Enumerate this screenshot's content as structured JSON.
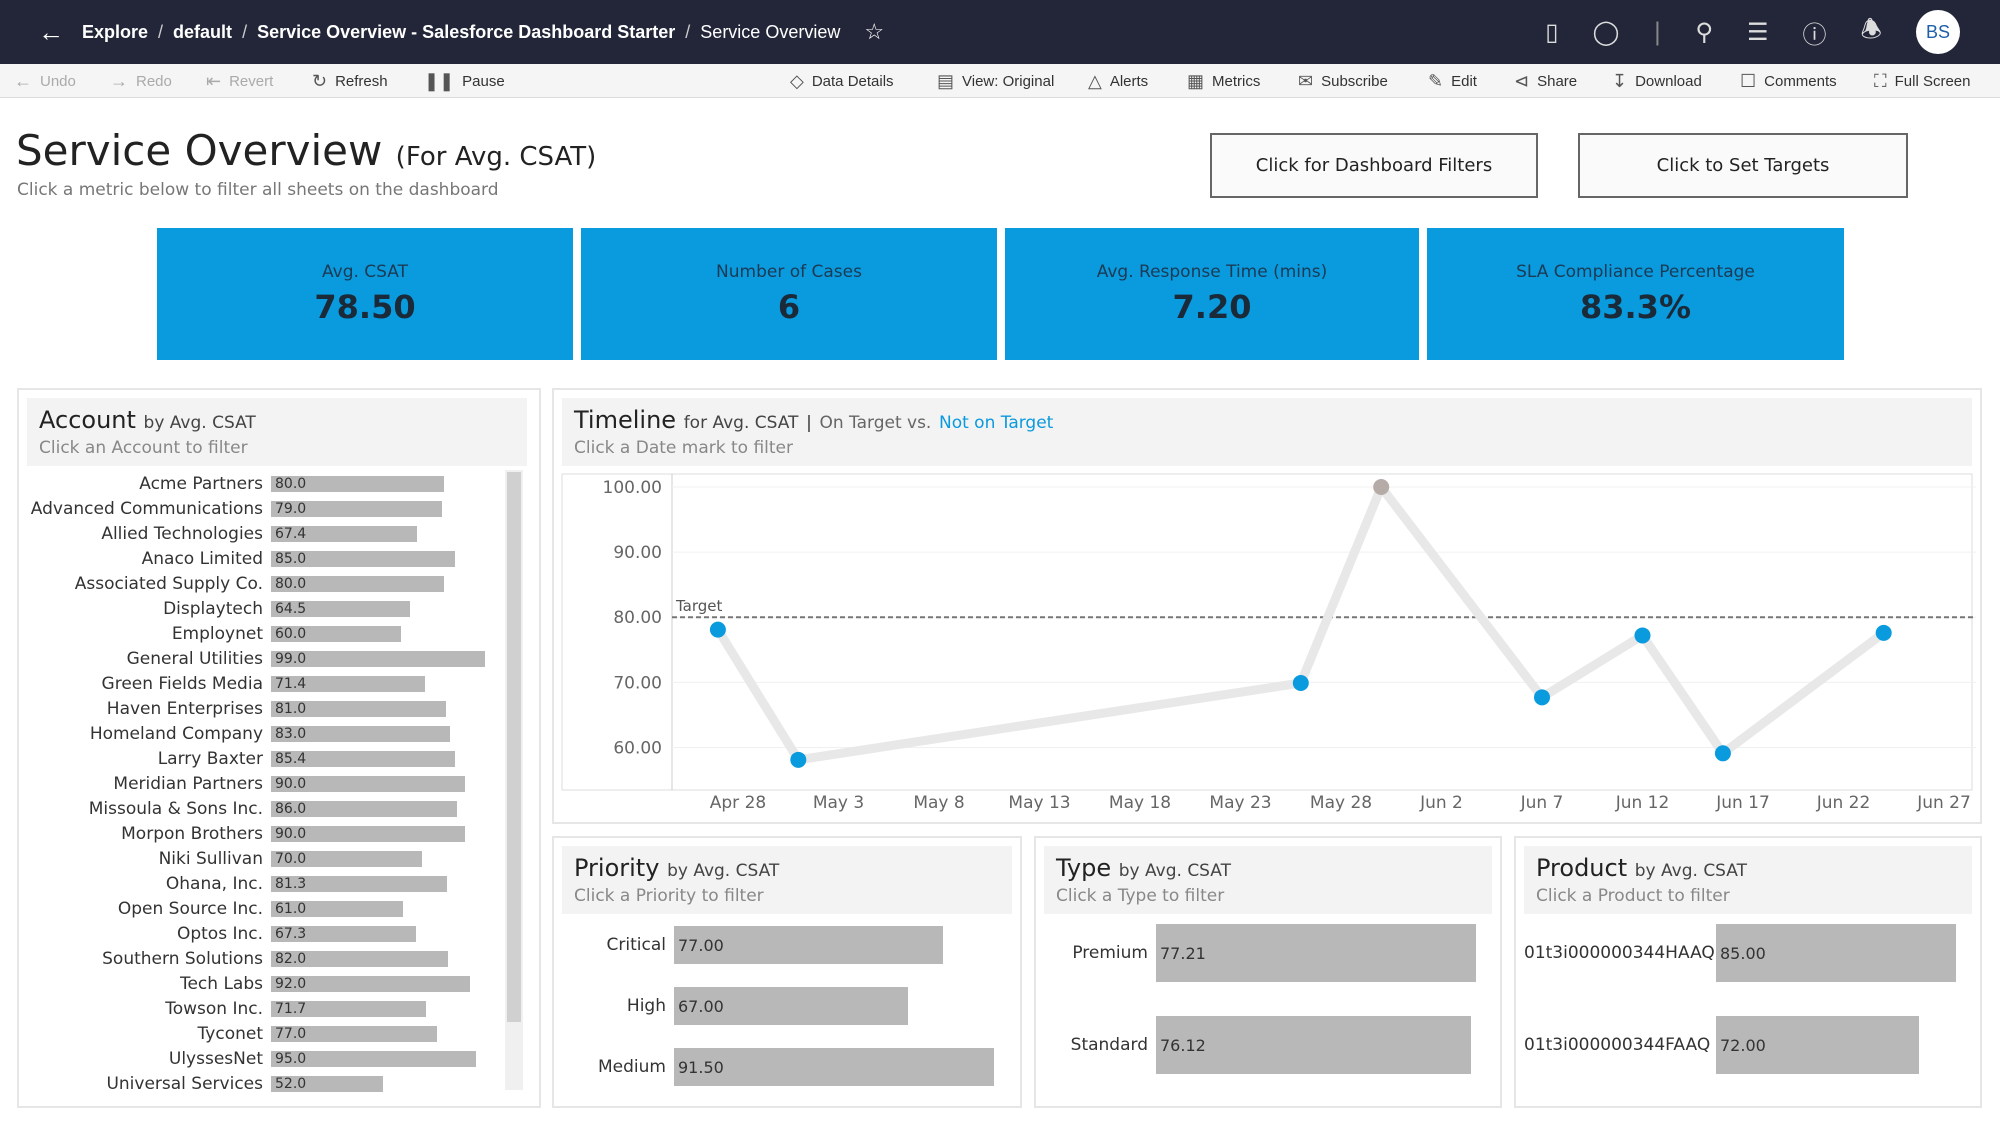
{
  "breadcrumb": {
    "items": [
      "Explore",
      "default",
      "Service Overview - Salesforce Dashboard Starter",
      "Service Overview"
    ]
  },
  "user": {
    "initials": "BS"
  },
  "toolbar": {
    "undo": "Undo",
    "redo": "Redo",
    "revert": "Revert",
    "refresh": "Refresh",
    "pause": "Pause",
    "data_details": "Data Details",
    "view": "View: Original",
    "alerts": "Alerts",
    "metrics": "Metrics",
    "subscribe": "Subscribe",
    "edit": "Edit",
    "share": "Share",
    "download": "Download",
    "comments": "Comments",
    "full_screen": "Full Screen"
  },
  "header": {
    "title": "Service Overview",
    "title_suffix": "(For Avg. CSAT)",
    "subtitle": "Click a metric below to filter all sheets on the dashboard",
    "filters_button": "Click for Dashboard Filters",
    "targets_button": "Click to Set Targets"
  },
  "kpis": [
    {
      "label": "Avg. CSAT",
      "value": "78.50"
    },
    {
      "label": "Number of Cases",
      "value": "6"
    },
    {
      "label": "Avg. Response Time (mins)",
      "value": "7.20"
    },
    {
      "label": "SLA Compliance Percentage",
      "value": "83.3%"
    }
  ],
  "colors": {
    "accent": "#0a9ade",
    "topbar": "#222638",
    "bar": "#b8b8b8",
    "not_on_target": "#0a9ade",
    "on_target": "#b5aca8"
  },
  "account": {
    "title": "Account",
    "title_suffix": "by Avg. CSAT",
    "subtitle": "Click an Account to filter",
    "items": [
      {
        "name": "Acme Partners",
        "value": "80.0"
      },
      {
        "name": "Advanced Communications",
        "value": "79.0"
      },
      {
        "name": "Allied Technologies",
        "value": "67.4"
      },
      {
        "name": "Anaco Limited",
        "value": "85.0"
      },
      {
        "name": "Associated Supply Co.",
        "value": "80.0"
      },
      {
        "name": "Displaytech",
        "value": "64.5"
      },
      {
        "name": "Employnet",
        "value": "60.0"
      },
      {
        "name": "General Utilities",
        "value": "99.0"
      },
      {
        "name": "Green Fields Media",
        "value": "71.4"
      },
      {
        "name": "Haven Enterprises",
        "value": "81.0"
      },
      {
        "name": "Homeland Company",
        "value": "83.0"
      },
      {
        "name": "Larry Baxter",
        "value": "85.4"
      },
      {
        "name": "Meridian Partners",
        "value": "90.0"
      },
      {
        "name": "Missoula & Sons Inc.",
        "value": "86.0"
      },
      {
        "name": "Morpon Brothers",
        "value": "90.0"
      },
      {
        "name": "Niki Sullivan",
        "value": "70.0"
      },
      {
        "name": "Ohana, Inc.",
        "value": "81.3"
      },
      {
        "name": "Open Source Inc.",
        "value": "61.0"
      },
      {
        "name": "Optos Inc.",
        "value": "67.3"
      },
      {
        "name": "Southern Solutions",
        "value": "82.0"
      },
      {
        "name": "Tech Labs",
        "value": "92.0"
      },
      {
        "name": "Towson Inc.",
        "value": "71.7"
      },
      {
        "name": "Tyconet",
        "value": "77.0"
      },
      {
        "name": "UlyssesNet",
        "value": "95.0"
      },
      {
        "name": "Universal Services",
        "value": "52.0"
      }
    ]
  },
  "timeline": {
    "title": "Timeline",
    "title_suffix": "for Avg. CSAT",
    "legend_on": "On Target vs.",
    "legend_not": "Not on Target",
    "subtitle": "Click a Date mark to filter"
  },
  "chart_data": {
    "type": "line",
    "y_ticks": [
      "100.00",
      "90.00",
      "80.00",
      "70.00",
      "60.00"
    ],
    "ylim": [
      55,
      102
    ],
    "x_ticks": [
      "Apr 28",
      "May 3",
      "May 8",
      "May 13",
      "May 18",
      "May 23",
      "May 28",
      "Jun 2",
      "Jun 7",
      "Jun 12",
      "Jun 17",
      "Jun 22",
      "Jun 27"
    ],
    "target": {
      "label": "Target",
      "value": 80
    },
    "points": [
      {
        "x": "Apr 27",
        "y": 78.1,
        "on_target": false
      },
      {
        "x": "May 1",
        "y": 58.1,
        "on_target": false
      },
      {
        "x": "May 26",
        "y": 69.9,
        "on_target": false
      },
      {
        "x": "May 30",
        "y": 100,
        "on_target": true
      },
      {
        "x": "Jun 7",
        "y": 67.7,
        "on_target": false
      },
      {
        "x": "Jun 12",
        "y": 77.2,
        "on_target": false
      },
      {
        "x": "Jun 16",
        "y": 59.1,
        "on_target": false
      },
      {
        "x": "Jun 24",
        "y": 77.6,
        "on_target": false
      }
    ]
  },
  "priority": {
    "title": "Priority",
    "title_suffix": "by Avg. CSAT",
    "subtitle": "Click a Priority to filter",
    "items": [
      {
        "name": "Critical",
        "value": "77.00"
      },
      {
        "name": "High",
        "value": "67.00"
      },
      {
        "name": "Medium",
        "value": "91.50"
      }
    ]
  },
  "type": {
    "title": "Type",
    "title_suffix": "by Avg. CSAT",
    "subtitle": "Click a Type to filter",
    "items": [
      {
        "name": "Premium",
        "value": "77.21"
      },
      {
        "name": "Standard",
        "value": "76.12"
      }
    ]
  },
  "product": {
    "title": "Product",
    "title_suffix": "by Avg. CSAT",
    "subtitle": "Click a Product to filter",
    "items": [
      {
        "name": "01t3i000000344HAAQ",
        "value": "85.00"
      },
      {
        "name": "01t3i000000344FAAQ",
        "value": "72.00"
      }
    ]
  }
}
